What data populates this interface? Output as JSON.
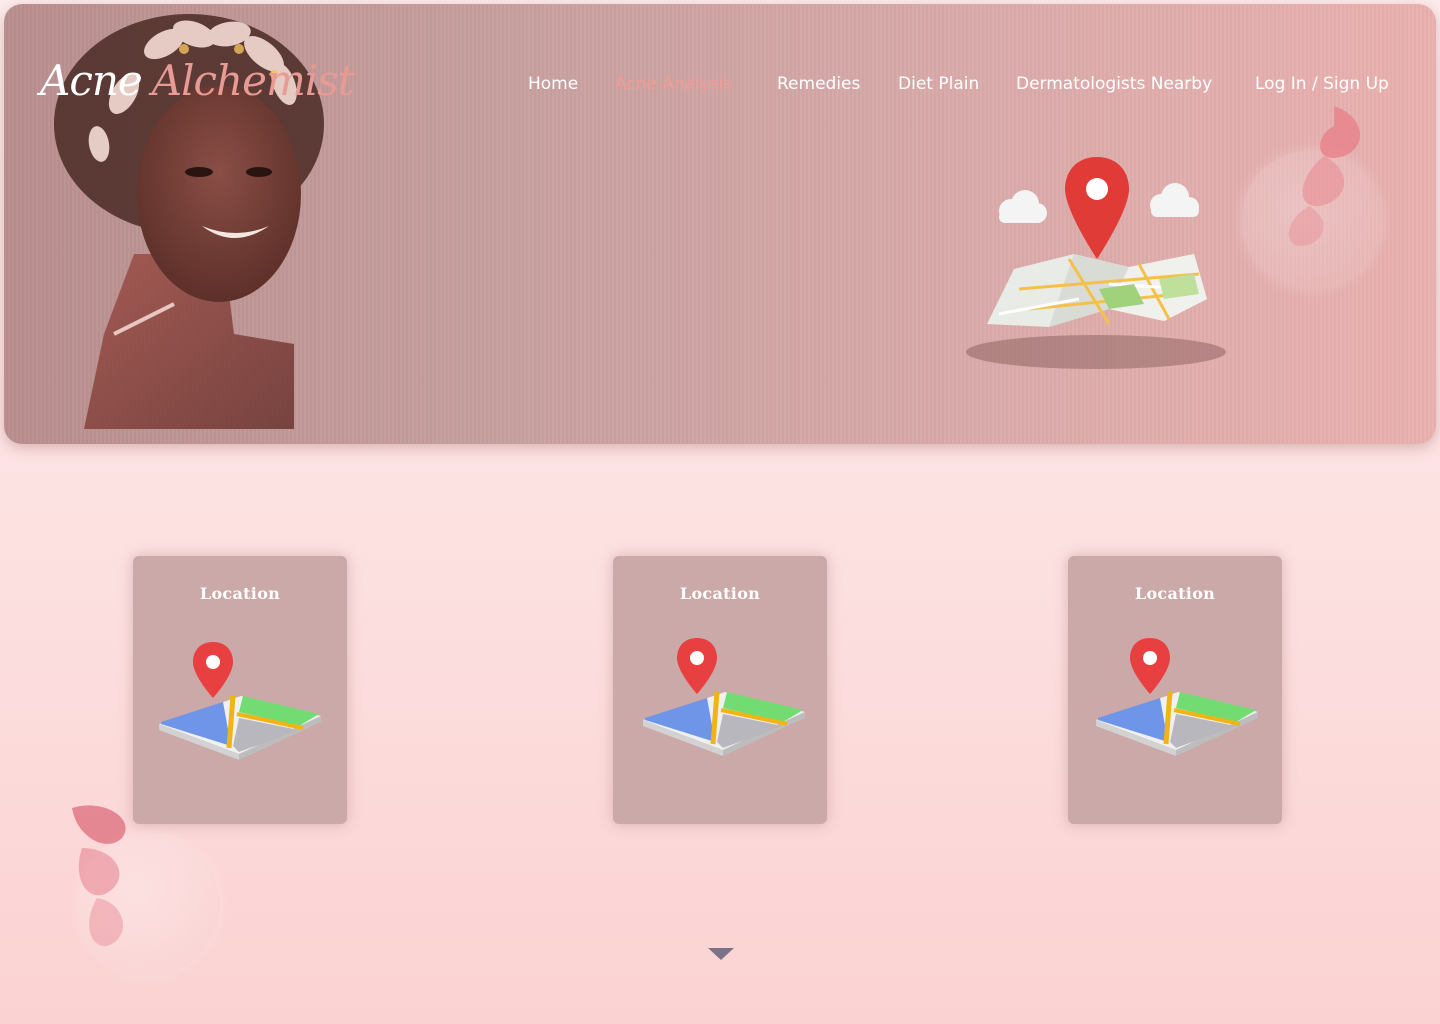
{
  "brand": {
    "word1": "Acne",
    "word2": "Alchemist"
  },
  "nav": {
    "items": [
      {
        "label": "Home",
        "active": false
      },
      {
        "label": "Acne Analysis",
        "active": true
      },
      {
        "label": "Remedies",
        "active": false
      },
      {
        "label": "Diet Plain",
        "active": false
      },
      {
        "label": "Dermatologists Nearby",
        "active": false
      },
      {
        "label": "Log In / Sign Up",
        "active": false
      }
    ]
  },
  "cards": [
    {
      "title": "Location",
      "icon": "map-pin-icon"
    },
    {
      "title": "Location",
      "icon": "map-pin-icon"
    },
    {
      "title": "Location",
      "icon": "map-pin-icon"
    }
  ],
  "icons": {
    "hero": "map-with-location-pin-icon",
    "scroll": "chevron-down-icon"
  },
  "colors": {
    "hero_start": "#b98f8e",
    "hero_end": "#eab1b0",
    "accent": "#ef9c96",
    "card_bg": "#cba9a8",
    "page_bg": "#fde3e3",
    "pin": "#e03b36"
  }
}
